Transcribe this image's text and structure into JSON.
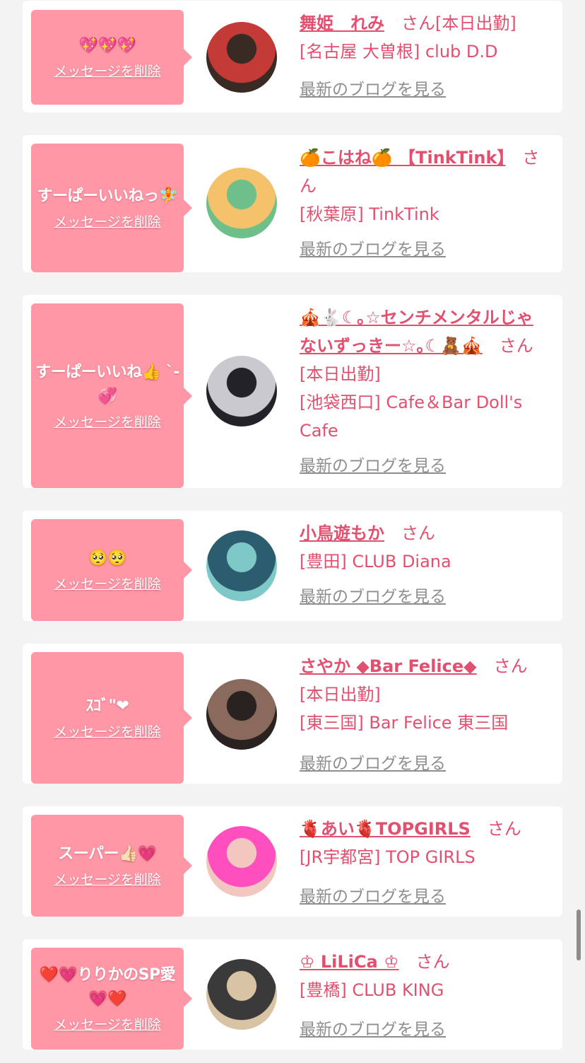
{
  "colors": {
    "page_bg": "#f3f3f3",
    "card_bg": "#ffffff",
    "bubble_bg": "#ff97a7",
    "accent": "#e2506f",
    "link_gray": "#8e8e8e"
  },
  "delete_label": "メッセージを削除",
  "blog_label": "最新のブログを見る",
  "honorific": "さん",
  "items": [
    {
      "message": "💖💖💖",
      "name": "舞姫　れみ",
      "suffix": "[本日出勤]",
      "details": [
        "[名古屋 大曽根] club D.D"
      ],
      "avatar_colors": [
        "#3a2a24",
        "#c43a36"
      ]
    },
    {
      "message": "すーぱーいいねっ🧚",
      "name": "🍊こはね🍊 【TinkTink】",
      "suffix": "",
      "details": [
        "[秋葉原] TinkTink"
      ],
      "avatar_colors": [
        "#6fbf8a",
        "#f3c26a"
      ]
    },
    {
      "message": "すーぱーいいね👍 ˋ-💞",
      "name": "🎪🐇☾｡☆センチメンタルじゃないずっきー☆｡☾🧸🎪",
      "suffix": "",
      "details": [
        "[本日出勤]",
        "[池袋西口] Cafe＆Bar Doll's Cafe"
      ],
      "avatar_colors": [
        "#222228",
        "#c9c9cf"
      ]
    },
    {
      "message": "🥺🥺",
      "name": "小鳥遊もか",
      "suffix": "",
      "details": [
        "[豊田] CLUB Diana"
      ],
      "avatar_colors": [
        "#7ec8c8",
        "#2b5d6e"
      ]
    },
    {
      "message": "ｽｺﾞ\"❤",
      "name": "さやか ◆Bar Felice◆",
      "suffix": "[本日出勤]",
      "details": [
        "[東三国] Bar Felice 東三国"
      ],
      "avatar_colors": [
        "#2a2220",
        "#8a6a5c"
      ]
    },
    {
      "message": "スーパー👍🏻💗",
      "name": "🫀あい🫀TOPGIRLS",
      "suffix": "",
      "details": [
        "[JR宇都宮] TOP GIRLS"
      ],
      "avatar_colors": [
        "#f2c7c0",
        "#ff4fbf"
      ]
    },
    {
      "message": "❤️💗りりかのSP愛💗❤️",
      "name": "♔ LiLiCa ♔",
      "suffix": "",
      "details": [
        "[豊橋] CLUB KING"
      ],
      "avatar_colors": [
        "#d9c3a5",
        "#3a3a3a"
      ]
    }
  ]
}
